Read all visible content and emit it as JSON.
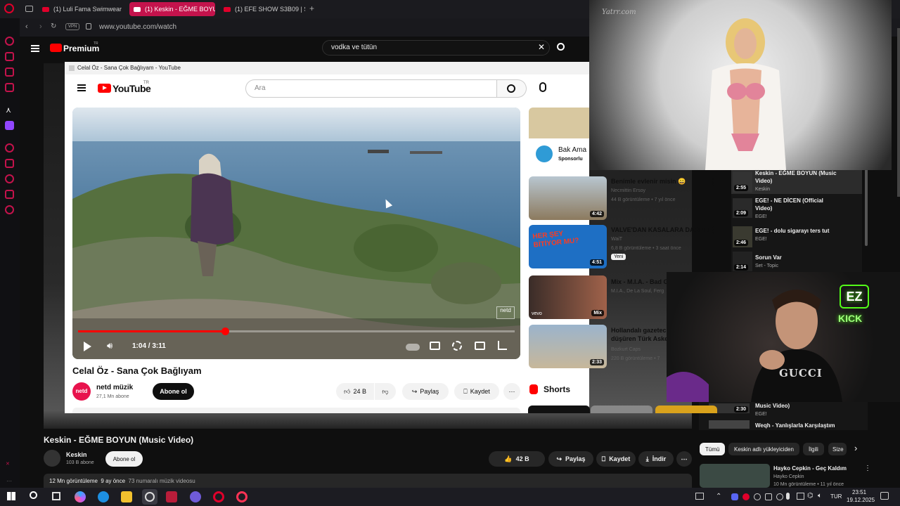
{
  "browser": {
    "tabs": [
      {
        "label": "(1) Luli Fama Swimwear F",
        "active": false
      },
      {
        "label": "(1) Keskin - EĞME BOYUN",
        "active": true
      },
      {
        "label": "(1) EFE SHOW S3B09 | Ş A",
        "active": false
      }
    ],
    "vpn_badge": "VPN",
    "url": "www.youtube.com/watch"
  },
  "yt": {
    "logo": "Premium",
    "logo_sup": "TR",
    "search_value": "vodka ve tütün",
    "video_title": "Keskin - EĞME BOYUN (Music Video)",
    "channel": "Keskin",
    "subscribers": "103 B abone",
    "subscribe_label": "Abone ol",
    "likes": "42 B",
    "share": "Paylaş",
    "save": "Kaydet",
    "download": "İndir",
    "stats_views": "12 Mn görüntüleme",
    "stats_time": "9 ay önce",
    "stats_tag": "73 numaralı müzik videosu"
  },
  "popup": {
    "window_title": "Celal Öz - Sana Çok Bağlıyam - YouTube",
    "logo": "YouTube",
    "logo_sup": "TR",
    "search_placeholder": "Ara",
    "time": "1:04 / 3:11",
    "progress_fraction": 0.336,
    "video_title": "Celal Öz - Sana Çok Bağlıyam",
    "channel": "netd müzik",
    "channel_avatar_text": "netd",
    "subscribers": "27,1 Mn abone",
    "subscribe_label": "Abone ol",
    "likes": "24 B",
    "share": "Paylaş",
    "save": "Kaydet",
    "ad": {
      "title": "Bak Ama",
      "tag": "Sponsorlu"
    },
    "recommendations": [
      {
        "title": "Benimle evlenir misin 😄",
        "channel": "Necmittin Ersoy",
        "meta": "44 B görüntüleme • 7 yıl önce",
        "duration": "4:42",
        "badge": ""
      },
      {
        "title": "VALVE'DAN KASALARA DARBE!",
        "channel": "WaiT",
        "meta": "6,8 B görüntüleme • 3 saat önce",
        "duration": "4:51",
        "badge": "Yeni",
        "thumb_text": "HER ŞEY BİTİYOR MU?"
      },
      {
        "title": "Mix - M.I.A. - Bad G",
        "channel": "M.I.A., De La Soul, Ferg",
        "meta": "",
        "duration": "Mix",
        "badge": "",
        "thumb_text": "vevo"
      },
      {
        "title": "Hollandalı gazeteci",
        "title2": "düşüren Türk Asker",
        "channel": "Bozkurt Caps",
        "meta": "220 B görüntüleme • 7",
        "duration": "2:33",
        "badge": ""
      }
    ],
    "shorts_label": "Shorts"
  },
  "playlist": [
    {
      "title": "Keskin - EĞME BOYUN (Music",
      "title2": "Video)",
      "sub": "Keskin",
      "duration": "2:55"
    },
    {
      "title": "EGE! - NE DİCEN (Official",
      "title2": "Video)",
      "sub": "EGE!",
      "duration": "2:09"
    },
    {
      "title": "EGE! - dolu sigarayı ters tut",
      "title2": "",
      "sub": "EGE!",
      "duration": "2:46"
    },
    {
      "title": "Sorun Var",
      "title2": "",
      "sub": "Set - Topic",
      "duration": "2:14"
    },
    {
      "title": "Music Video)",
      "title2": "",
      "sub": "EGE!",
      "duration": "2:30"
    },
    {
      "title": "Weqh - Yanlışlarla Karşılaştım",
      "title2": "",
      "sub": "",
      "duration": ""
    }
  ],
  "chips": [
    "Tümü",
    "Keskin adlı yükleyiciden",
    "İlgili",
    "Size"
  ],
  "right_rec": {
    "title": "Hayko Cepkin - Geç Kaldım",
    "channel": "Hayko Cepkin",
    "meta": "10 Mn görüntüleme • 11 yıl önce"
  },
  "overlays": {
    "watermark": "Yatrr.com",
    "neon_top": "EZ",
    "neon_bottom": "KICK",
    "shirt_text": "GUCCI"
  },
  "taskbar": {
    "language": "TUR",
    "time": "23:51",
    "date": "19.12.2025"
  },
  "colors": {
    "yt_red": "#ff0000",
    "opera_red": "#e0002b",
    "kick_green": "#53fc18"
  }
}
